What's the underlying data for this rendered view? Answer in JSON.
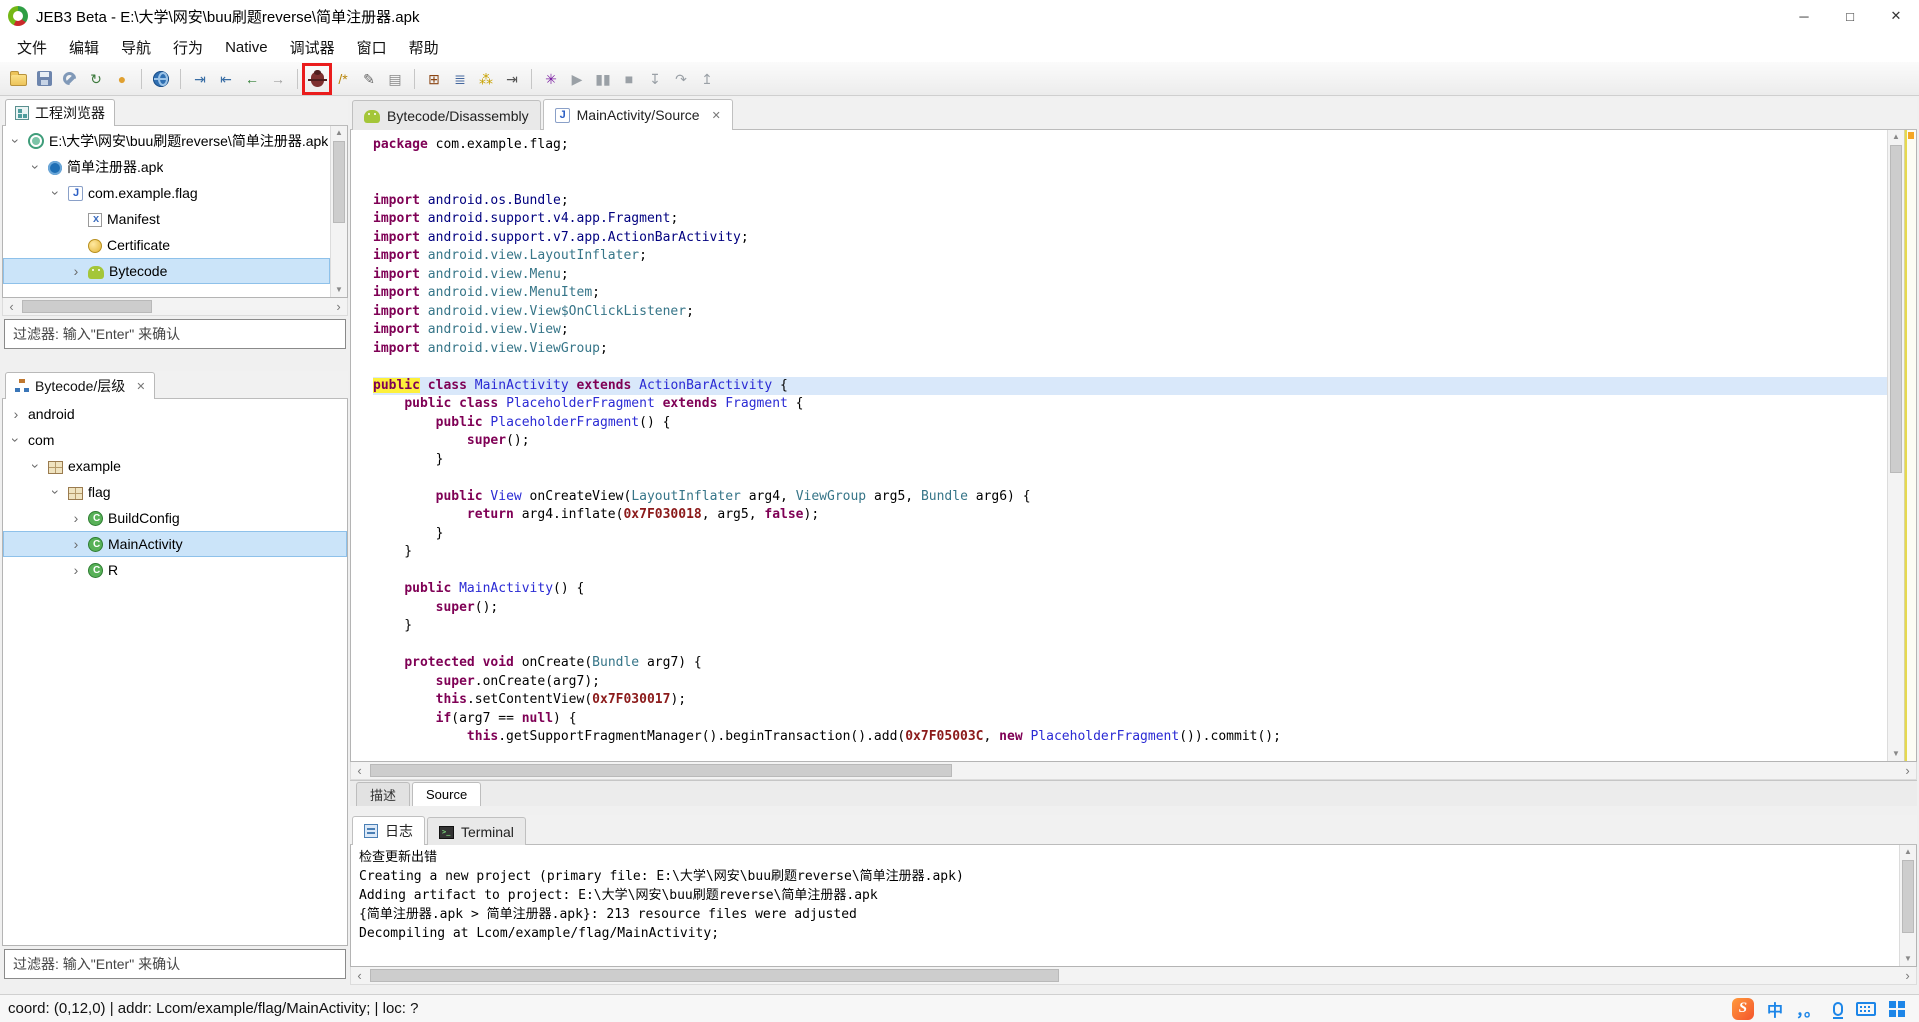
{
  "window": {
    "title": "JEB3 Beta - E:\\大学\\网安\\buu刷题reverse\\简单注册器.apk",
    "controls": [
      {
        "name": "minimize",
        "glyph": "─"
      },
      {
        "name": "maximize",
        "glyph": "□"
      },
      {
        "name": "close",
        "glyph": "✕"
      }
    ]
  },
  "menu": {
    "items": [
      "文件",
      "编辑",
      "导航",
      "行为",
      "Native",
      "调试器",
      "窗口",
      "帮助"
    ]
  },
  "toolbar": {
    "items": [
      {
        "name": "open-file",
        "icon": "folder"
      },
      {
        "name": "save",
        "icon": "floppy"
      },
      {
        "name": "settings-wrench",
        "icon": "wrench"
      },
      {
        "name": "refresh",
        "glyph": "↻",
        "color": "#3d7a3d"
      },
      {
        "name": "lock",
        "glyph": "●",
        "color": "#e0a030"
      },
      {
        "sep": true
      },
      {
        "name": "globe",
        "icon": "globe"
      },
      {
        "sep": true
      },
      {
        "name": "jump-to",
        "glyph": "⇥",
        "color": "#3a6ea5"
      },
      {
        "name": "jump-back",
        "glyph": "⇤",
        "color": "#3a6ea5"
      },
      {
        "name": "nav-back",
        "glyph": "←",
        "color": "#2e7d32"
      },
      {
        "name": "nav-forward",
        "glyph": "→",
        "color": "#9e9e9e"
      },
      {
        "sep": true
      },
      {
        "name": "debugger",
        "icon": "bug",
        "boxed": true
      },
      {
        "name": "comment",
        "glyph": "/*",
        "color": "#b8860b"
      },
      {
        "name": "rename",
        "glyph": "✎",
        "color": "#666666"
      },
      {
        "name": "document",
        "glyph": "▤",
        "color": "#888888"
      },
      {
        "sep": true
      },
      {
        "name": "matrix-view",
        "glyph": "⊞",
        "color": "#8b4513"
      },
      {
        "name": "stack-view",
        "glyph": "≣",
        "color": "#44679f"
      },
      {
        "name": "keys",
        "glyph": "⁂",
        "color": "#c8a200"
      },
      {
        "name": "indent",
        "glyph": "⇥",
        "color": "#555555"
      },
      {
        "sep": true
      },
      {
        "name": "debug-start",
        "glyph": "✳",
        "color": "#7b1fa2"
      },
      {
        "name": "run",
        "glyph": "▶",
        "color": "#9aa0a6"
      },
      {
        "name": "pause",
        "glyph": "▮▮",
        "color": "#9aa0a6"
      },
      {
        "name": "stop",
        "glyph": "■",
        "color": "#9aa0a6"
      },
      {
        "name": "step-into",
        "glyph": "↧",
        "color": "#9aa0a6"
      },
      {
        "name": "step-over",
        "glyph": "↷",
        "color": "#9aa0a6"
      },
      {
        "name": "step-out",
        "glyph": "↥",
        "color": "#9aa0a6"
      }
    ]
  },
  "project_panel": {
    "title": "工程浏览器",
    "filter_placeholder": "过滤器: 输入\"Enter\" 来确认",
    "tree": [
      {
        "label": "E:\\大学\\网安\\buu刷题reverse\\简单注册器.apk",
        "depth": 0,
        "exp": "open",
        "icon": "project"
      },
      {
        "label": "简单注册器.apk",
        "depth": 1,
        "exp": "open",
        "icon": "apk"
      },
      {
        "label": "com.example.flag",
        "depth": 2,
        "exp": "open",
        "icon": "java"
      },
      {
        "label": "Manifest",
        "depth": 3,
        "exp": "none",
        "icon": "manifest"
      },
      {
        "label": "Certificate",
        "depth": 3,
        "exp": "none",
        "icon": "cert"
      },
      {
        "label": "Bytecode",
        "depth": 3,
        "exp": "closed",
        "icon": "android",
        "selected": true
      }
    ]
  },
  "hierarchy_panel": {
    "title": "Bytecode/层级",
    "filter_placeholder": "过滤器: 输入\"Enter\" 来确认",
    "tree": [
      {
        "label": "android",
        "depth": 0,
        "exp": "closed"
      },
      {
        "label": "com",
        "depth": 0,
        "exp": "open"
      },
      {
        "label": "example",
        "depth": 1,
        "exp": "open",
        "icon": "package"
      },
      {
        "label": "flag",
        "depth": 2,
        "exp": "open",
        "icon": "package"
      },
      {
        "label": "BuildConfig",
        "depth": 3,
        "exp": "closed",
        "icon": "class"
      },
      {
        "label": "MainActivity",
        "depth": 3,
        "exp": "closed",
        "icon": "class",
        "selected": true
      },
      {
        "label": "R",
        "depth": 3,
        "exp": "closed",
        "icon": "class"
      }
    ]
  },
  "editor": {
    "tabs": [
      {
        "label": "Bytecode/Disassembly",
        "icon": "android",
        "active": false,
        "closable": false
      },
      {
        "label": "MainActivity/Source",
        "icon": "java",
        "active": true,
        "closable": true
      }
    ],
    "bottom_tabs": [
      {
        "label": "描述",
        "active": false
      },
      {
        "label": "Source",
        "active": true
      }
    ],
    "code": [
      {
        "t": [
          [
            "package ",
            "k"
          ],
          [
            "com.example.flag;",
            "p"
          ]
        ]
      },
      {
        "t": []
      },
      {
        "t": []
      },
      {
        "t": [
          [
            "import ",
            "k"
          ],
          [
            "android.os.Bundle",
            "i"
          ],
          [
            ";",
            "p"
          ]
        ]
      },
      {
        "t": [
          [
            "import ",
            "k"
          ],
          [
            "android.support.v4.app.Fragment",
            "i"
          ],
          [
            ";",
            "p"
          ]
        ]
      },
      {
        "t": [
          [
            "import ",
            "k"
          ],
          [
            "android.support.v7.app.ActionBarActivity",
            "i"
          ],
          [
            ";",
            "p"
          ]
        ]
      },
      {
        "t": [
          [
            "import ",
            "k"
          ],
          [
            "android.view.LayoutInflater",
            "r"
          ],
          [
            ";",
            "p"
          ]
        ]
      },
      {
        "t": [
          [
            "import ",
            "k"
          ],
          [
            "android.view.Menu",
            "r"
          ],
          [
            ";",
            "p"
          ]
        ]
      },
      {
        "t": [
          [
            "import ",
            "k"
          ],
          [
            "android.view.MenuItem",
            "r"
          ],
          [
            ";",
            "p"
          ]
        ]
      },
      {
        "t": [
          [
            "import ",
            "k"
          ],
          [
            "android.view.View$OnClickListener",
            "r"
          ],
          [
            ";",
            "p"
          ]
        ]
      },
      {
        "t": [
          [
            "import ",
            "k"
          ],
          [
            "android.view.View",
            "r"
          ],
          [
            ";",
            "p"
          ]
        ]
      },
      {
        "t": [
          [
            "import ",
            "k"
          ],
          [
            "android.view.ViewGroup",
            "r"
          ],
          [
            ";",
            "p"
          ]
        ]
      },
      {
        "t": []
      },
      {
        "h": true,
        "t": [
          [
            "public",
            "km"
          ],
          [
            " ",
            "p"
          ],
          [
            "class ",
            "k"
          ],
          [
            "MainActivity",
            "c"
          ],
          [
            " ",
            "p"
          ],
          [
            "extends ",
            "k"
          ],
          [
            "ActionBarActivity",
            "c"
          ],
          [
            " {",
            "p"
          ]
        ]
      },
      {
        "t": [
          [
            "    ",
            "p"
          ],
          [
            "public class ",
            "k"
          ],
          [
            "PlaceholderFragment",
            "c"
          ],
          [
            " ",
            "p"
          ],
          [
            "extends ",
            "k"
          ],
          [
            "Fragment",
            "c"
          ],
          [
            " {",
            "p"
          ]
        ]
      },
      {
        "t": [
          [
            "        ",
            "p"
          ],
          [
            "public ",
            "k"
          ],
          [
            "PlaceholderFragment",
            "c"
          ],
          [
            "() {",
            "p"
          ]
        ]
      },
      {
        "t": [
          [
            "            ",
            "p"
          ],
          [
            "super",
            "k"
          ],
          [
            "();",
            "p"
          ]
        ]
      },
      {
        "t": [
          [
            "        }",
            "p"
          ]
        ]
      },
      {
        "t": []
      },
      {
        "t": [
          [
            "        ",
            "p"
          ],
          [
            "public ",
            "k"
          ],
          [
            "View",
            "c"
          ],
          [
            " onCreateView(",
            "p"
          ],
          [
            "LayoutInflater",
            "r"
          ],
          [
            " arg4, ",
            "p"
          ],
          [
            "ViewGroup",
            "r"
          ],
          [
            " arg5, ",
            "p"
          ],
          [
            "Bundle",
            "r"
          ],
          [
            " arg6) {",
            "p"
          ]
        ]
      },
      {
        "t": [
          [
            "            ",
            "p"
          ],
          [
            "return ",
            "k"
          ],
          [
            "arg4.inflate(",
            "p"
          ],
          [
            "0x7F030018",
            "n"
          ],
          [
            ", arg5, ",
            "p"
          ],
          [
            "false",
            "k"
          ],
          [
            ");",
            "p"
          ]
        ]
      },
      {
        "t": [
          [
            "        }",
            "p"
          ]
        ]
      },
      {
        "t": [
          [
            "    }",
            "p"
          ]
        ]
      },
      {
        "t": []
      },
      {
        "t": [
          [
            "    ",
            "p"
          ],
          [
            "public ",
            "k"
          ],
          [
            "MainActivity",
            "c"
          ],
          [
            "() {",
            "p"
          ]
        ]
      },
      {
        "t": [
          [
            "        ",
            "p"
          ],
          [
            "super",
            "k"
          ],
          [
            "();",
            "p"
          ]
        ]
      },
      {
        "t": [
          [
            "    }",
            "p"
          ]
        ]
      },
      {
        "t": []
      },
      {
        "t": [
          [
            "    ",
            "p"
          ],
          [
            "protected void ",
            "k"
          ],
          [
            "onCreate(",
            "p"
          ],
          [
            "Bundle",
            "r"
          ],
          [
            " arg7) {",
            "p"
          ]
        ]
      },
      {
        "t": [
          [
            "        ",
            "p"
          ],
          [
            "super",
            "k"
          ],
          [
            ".onCreate(arg7);",
            "p"
          ]
        ]
      },
      {
        "t": [
          [
            "        ",
            "p"
          ],
          [
            "this",
            "k"
          ],
          [
            ".setContentView(",
            "p"
          ],
          [
            "0x7F030017",
            "n"
          ],
          [
            ");",
            "p"
          ]
        ]
      },
      {
        "t": [
          [
            "        ",
            "p"
          ],
          [
            "if",
            "k"
          ],
          [
            "(arg7 == ",
            "p"
          ],
          [
            "null",
            "k"
          ],
          [
            ") {",
            "p"
          ]
        ]
      },
      {
        "t": [
          [
            "            ",
            "p"
          ],
          [
            "this",
            "k"
          ],
          [
            ".getSupportFragmentManager().beginTransaction().add(",
            "p"
          ],
          [
            "0x7F05003C",
            "n"
          ],
          [
            ", ",
            "p"
          ],
          [
            "new ",
            "k"
          ],
          [
            "PlaceholderFragment",
            "c"
          ],
          [
            "()).commit();",
            "p"
          ]
        ]
      }
    ]
  },
  "console": {
    "tabs": [
      {
        "label": "日志",
        "icon": "log",
        "active": true
      },
      {
        "label": "Terminal",
        "icon": "terminal",
        "active": false
      }
    ],
    "lines": [
      "检查更新出错",
      "Creating a new project (primary file: E:\\大学\\网安\\buu刷题reverse\\简单注册器.apk)",
      "Adding artifact to project: E:\\大学\\网安\\buu刷题reverse\\简单注册器.apk",
      "{简单注册器.apk > 简单注册器.apk}: 213 resource files were adjusted",
      "Decompiling at Lcom/example/flag/MainActivity;"
    ]
  },
  "status_bar": {
    "text": "coord: (0,12,0) | addr: Lcom/example/flag/MainActivity; | loc: ?"
  },
  "ime": {
    "items": [
      {
        "name": "sogou-logo",
        "cls": "ic-sogou",
        "glyph": "S"
      },
      {
        "name": "chinese-mode",
        "cls": "ime-txt",
        "glyph": "中"
      },
      {
        "name": "punctuation",
        "cls": "ime-txt",
        "glyph": "，。"
      },
      {
        "name": "microphone",
        "cls": "ic-mic"
      },
      {
        "name": "keyboard",
        "cls": "ic-keyboard"
      },
      {
        "name": "toolbox",
        "cls": "ic-grid4"
      }
    ]
  }
}
